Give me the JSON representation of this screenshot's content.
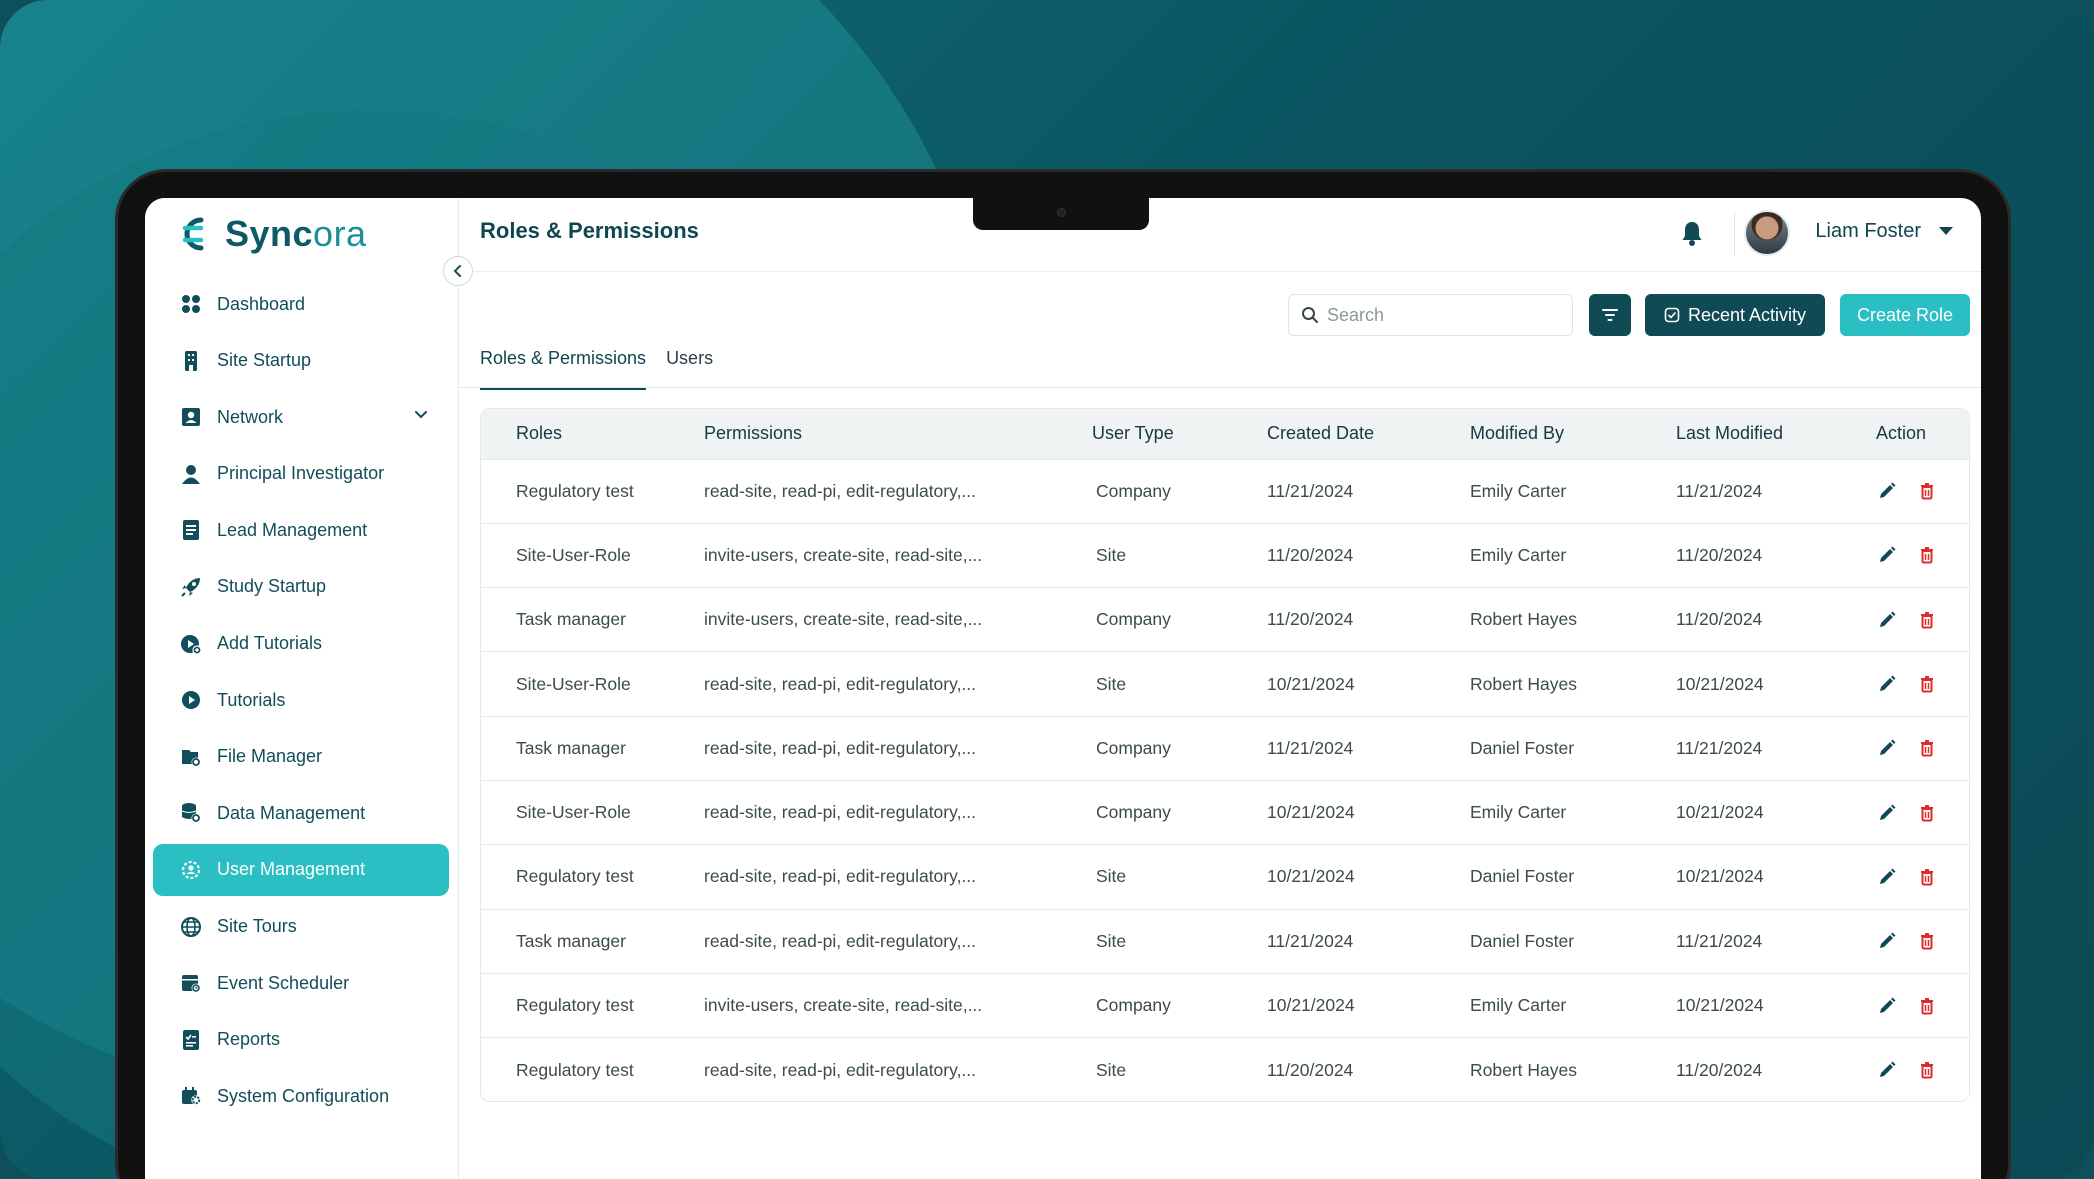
{
  "app": {
    "name_part1": "Sync",
    "name_part2": "ora"
  },
  "sidebar": {
    "items": [
      {
        "label": "Dashboard",
        "icon": "grid-icon"
      },
      {
        "label": "Site Startup",
        "icon": "building-icon"
      },
      {
        "label": "Network",
        "icon": "contact-card-icon"
      },
      {
        "label": "Principal Investigator",
        "icon": "person-icon"
      },
      {
        "label": "Lead Management",
        "icon": "document-list-icon"
      },
      {
        "label": "Study Startup",
        "icon": "rocket-icon"
      },
      {
        "label": "Add Tutorials",
        "icon": "play-add-icon"
      },
      {
        "label": "Tutorials",
        "icon": "play-icon"
      },
      {
        "label": "File Manager",
        "icon": "folder-gear-icon"
      },
      {
        "label": "Data Management",
        "icon": "database-gear-icon"
      },
      {
        "label": "User Management",
        "icon": "user-gear-icon"
      },
      {
        "label": "Site Tours",
        "icon": "globe-icon"
      },
      {
        "label": "Event Scheduler",
        "icon": "calendar-icon"
      },
      {
        "label": "Reports",
        "icon": "report-icon"
      },
      {
        "label": "System Configuration",
        "icon": "settings-icon"
      }
    ],
    "active": "User Management"
  },
  "header": {
    "title": "Roles & Permissions",
    "user_name": "Liam Foster"
  },
  "toolbar": {
    "search_placeholder": "Search",
    "recent_activity_label": "Recent Activity",
    "create_role_label": "Create Role"
  },
  "tabs": [
    {
      "label": "Roles & Permissions"
    },
    {
      "label": "Users"
    }
  ],
  "table": {
    "headers": [
      "Roles",
      "Permissions",
      "User Type",
      "Created Date",
      "Modified By",
      "Last Modified",
      "Action"
    ],
    "rows": [
      [
        "Regulatory test",
        "read-site, read-pi, edit-regulatory,...",
        "Company",
        "11/21/2024",
        "Emily Carter",
        "11/21/2024"
      ],
      [
        "Site-User-Role",
        "invite-users, create-site, read-site,...",
        "Site",
        "11/20/2024",
        "Emily Carter",
        "11/20/2024"
      ],
      [
        "Task manager",
        "invite-users, create-site, read-site,...",
        "Company",
        "11/20/2024",
        "Robert Hayes",
        "11/20/2024"
      ],
      [
        "Site-User-Role",
        "read-site, read-pi, edit-regulatory,...",
        "Site",
        "10/21/2024",
        "Robert Hayes",
        "10/21/2024"
      ],
      [
        "Task manager",
        "read-site, read-pi, edit-regulatory,...",
        "Company",
        "11/21/2024",
        "Daniel Foster",
        "11/21/2024"
      ],
      [
        "Site-User-Role",
        "read-site, read-pi, edit-regulatory,...",
        "Company",
        "10/21/2024",
        "Emily Carter",
        "10/21/2024"
      ],
      [
        "Regulatory test",
        "read-site, read-pi, edit-regulatory,...",
        "Site",
        "10/21/2024",
        "Daniel Foster",
        "10/21/2024"
      ],
      [
        "Task manager",
        "read-site, read-pi, edit-regulatory,...",
        "Site",
        "11/21/2024",
        "Daniel Foster",
        "11/21/2024"
      ],
      [
        "Regulatory test",
        "invite-users, create-site, read-site,...",
        "Company",
        "10/21/2024",
        "Emily Carter",
        "10/21/2024"
      ],
      [
        "Regulatory test",
        "read-site, read-pi, edit-regulatory,...",
        "Site",
        "11/20/2024",
        "Robert Hayes",
        "11/20/2024"
      ]
    ]
  },
  "colors": {
    "primary_dark": "#0f4a55",
    "accent_teal": "#2bbfc4",
    "delete_red": "#e02b2b",
    "background": "#0a5460"
  }
}
